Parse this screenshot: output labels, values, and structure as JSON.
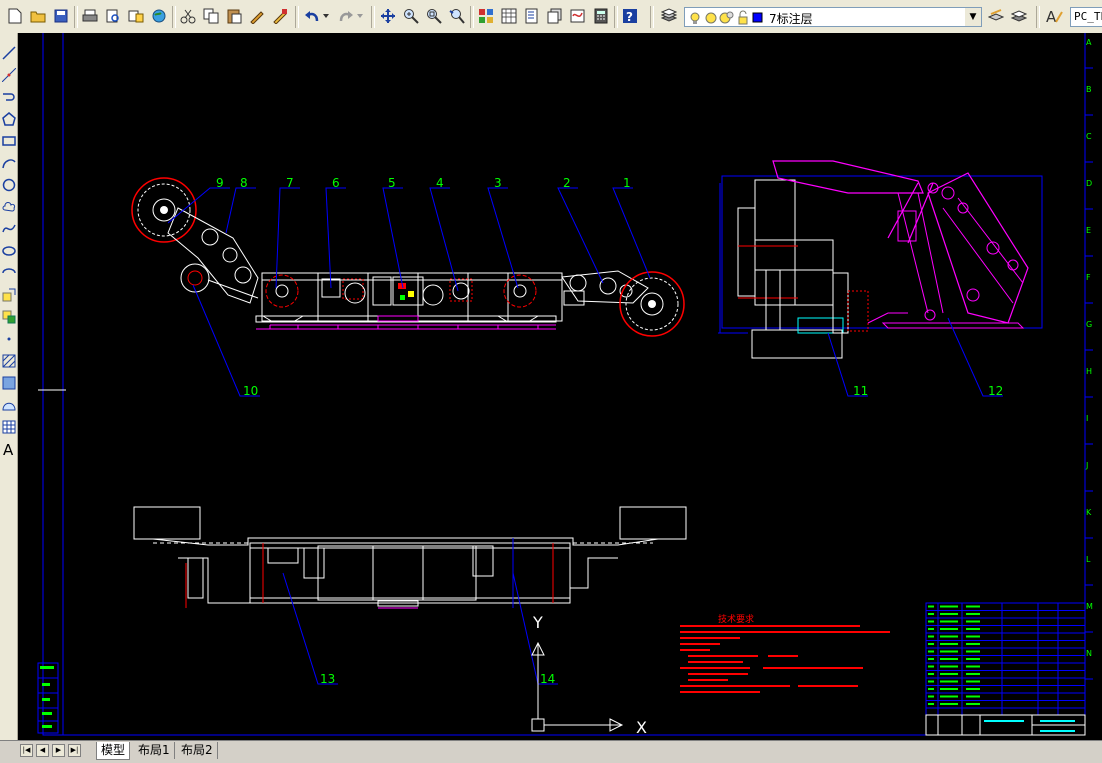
{
  "toolbar": {
    "layer_name": "7标注层",
    "text_style": "PC_TEXTSTYLE",
    "buttons": [
      "new-file-icon",
      "open-icon",
      "save-icon",
      "print-icon",
      "print-preview-icon",
      "publish-icon",
      "web-icon",
      "cut-icon",
      "copy-icon",
      "paste-icon",
      "match-properties-icon",
      "block-editor-icon",
      "undo-icon",
      "redo-icon",
      "pan-icon",
      "zoom-realtime-icon",
      "zoom-window-icon",
      "zoom-previous-icon",
      "properties-icon",
      "design-center-icon",
      "tool-palettes-icon",
      "sheet-set-icon",
      "markup-icon",
      "calculator-icon",
      "help-icon"
    ]
  },
  "left_tools": [
    "line-icon",
    "construction-line-icon",
    "polyline-icon",
    "polygon-icon",
    "rectangle-icon",
    "arc-icon",
    "circle-icon",
    "revision-cloud-icon",
    "spline-icon",
    "ellipse-icon",
    "ellipse-arc-icon",
    "insert-block-icon",
    "make-block-icon",
    "point-icon",
    "hatch-icon",
    "gradient-icon",
    "region-icon",
    "table-icon",
    "multiline-text-icon"
  ],
  "drawing": {
    "balloons": [
      "1",
      "2",
      "3",
      "4",
      "5",
      "6",
      "7",
      "8",
      "9",
      "10",
      "11",
      "12",
      "13",
      "14"
    ],
    "ucs_x": "X",
    "ucs_y": "Y",
    "border_rows": [
      "A",
      "B",
      "C",
      "D",
      "E",
      "F",
      "G",
      "H",
      "I",
      "J",
      "K",
      "L",
      "M",
      "N"
    ],
    "tech_title": "技术要求"
  },
  "tabs": {
    "model": "模型",
    "layout1": "布局1",
    "layout2": "布局2"
  },
  "colors": {
    "canvas": "#000000",
    "frame": "#0000ff",
    "outline": "#ffffff",
    "leader": "#0000ff",
    "balloon_text": "#00ff00",
    "magenta": "#ff00ff",
    "red": "#ff0000",
    "cyan": "#00ffff"
  }
}
